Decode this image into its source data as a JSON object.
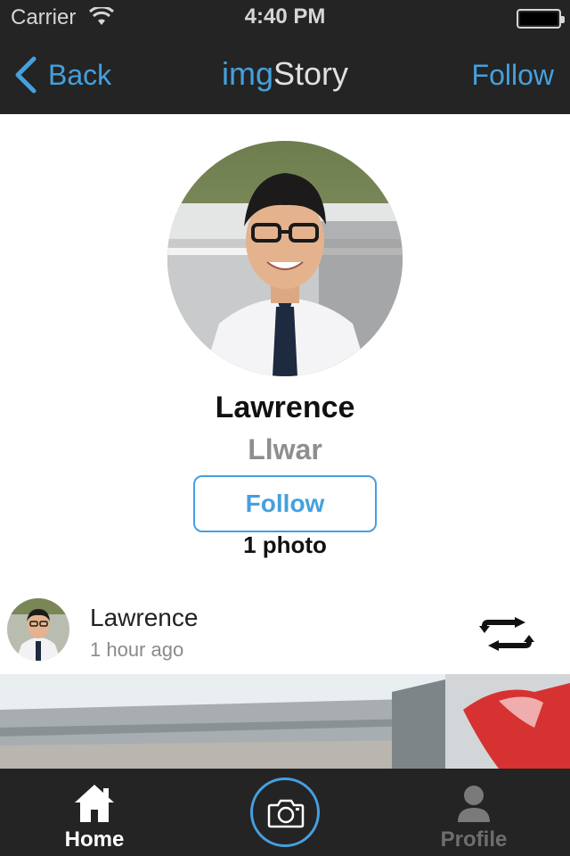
{
  "status_bar": {
    "carrier": "Carrier",
    "time": "4:40 PM"
  },
  "nav": {
    "back_label": "Back",
    "title_part1": "img",
    "title_part2": "Story",
    "follow_label": "Follow"
  },
  "profile": {
    "name": "Lawrence",
    "username": "Llwar",
    "follow_button": "Follow",
    "photo_count": "1 photo"
  },
  "post": {
    "author": "Lawrence",
    "time": "1 hour ago",
    "action_icon": "repost-icon"
  },
  "tabbar": {
    "home_label": "Home",
    "profile_label": "Profile",
    "camera_icon": "camera-icon"
  },
  "colors": {
    "accent": "#45a0de",
    "bar_background": "#242424",
    "muted_text": "#8e8e8e"
  }
}
